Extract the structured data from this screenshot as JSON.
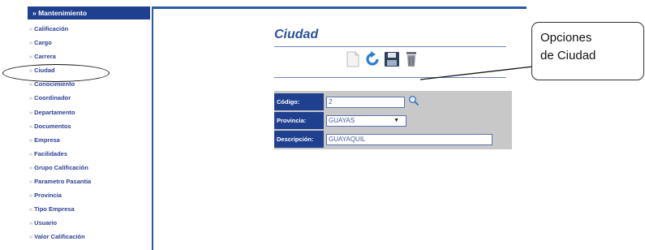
{
  "sidebar": {
    "header": "» Mantenimiento",
    "bullet": "»",
    "items": [
      {
        "label": "Calificación"
      },
      {
        "label": "Cargo"
      },
      {
        "label": "Carrera"
      },
      {
        "label": "Ciudad"
      },
      {
        "label": "Conocimiento"
      },
      {
        "label": "Coordinador"
      },
      {
        "label": "Departamento"
      },
      {
        "label": "Documentos"
      },
      {
        "label": "Empresa"
      },
      {
        "label": "Facilidades"
      },
      {
        "label": "Grupo Calificación"
      },
      {
        "label": "Parametro Pasantia"
      },
      {
        "label": "Provincia"
      },
      {
        "label": "Tipo Empresa"
      },
      {
        "label": "Usuario"
      },
      {
        "label": "Valor Calificación"
      }
    ]
  },
  "main": {
    "title": "Ciudad",
    "toolbar": [
      "new-icon",
      "refresh-icon",
      "save-icon",
      "delete-icon"
    ]
  },
  "callout": {
    "line1": "Opciones",
    "line2": "de Ciudad"
  },
  "form": {
    "codigo_label": "Código:",
    "codigo_value": "2",
    "provincia_label": "Provincia:",
    "provincia_value": "GUAYAS",
    "descripcion_label": "Descripción:",
    "descripcion_value": "GUAYAQUIL"
  },
  "colors": {
    "accent": "#1f3f8f",
    "link": "#2b3f93",
    "title": "#2c4f9c",
    "form_bg": "#c8c8c8"
  }
}
